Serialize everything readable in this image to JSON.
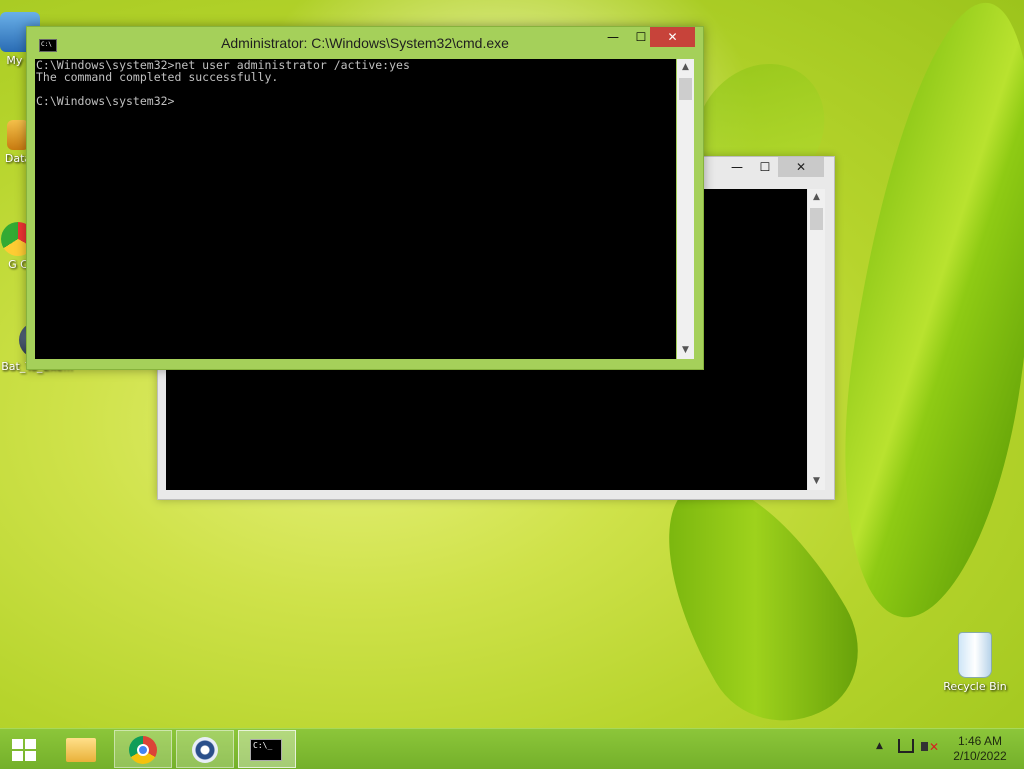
{
  "desktop": {
    "icons": [
      {
        "label": "My C",
        "icon": "computer-icon"
      },
      {
        "label": "Data",
        "icon": "data-icon"
      },
      {
        "label": "G C",
        "icon": "chrome-shortcut-icon"
      },
      {
        "label": "Bat_To_Exe...",
        "icon": "bat-to-exe-icon"
      },
      {
        "label": "Recycle Bin",
        "icon": "recycle-bin-icon"
      }
    ]
  },
  "front_window": {
    "title": "Administrator: C:\\Windows\\System32\\cmd.exe",
    "icon_text": "C:\\",
    "controls": {
      "minimize": "—",
      "maximize": "☐",
      "close": "✕"
    },
    "lines": [
      "C:\\Windows\\system32>net user administrator /active:yes",
      "The command completed successfully.",
      "",
      "C:\\Windows\\system32>"
    ]
  },
  "back_window": {
    "controls": {
      "minimize": "—",
      "maximize": "☐",
      "close": "✕"
    }
  },
  "scrollbar": {
    "up": "▲",
    "down": "▼"
  },
  "taskbar": {
    "items": [
      {
        "name": "start",
        "icon": "windows-logo-icon"
      },
      {
        "name": "file-explorer",
        "icon": "folder-icon"
      },
      {
        "name": "chrome",
        "icon": "chrome-icon"
      },
      {
        "name": "settings",
        "icon": "gear-icon"
      },
      {
        "name": "command-prompt",
        "icon": "cmd-icon"
      }
    ],
    "cmd_icon_text": "C:\\_",
    "tray_up": "▲",
    "volume_mark": "✕",
    "time": "1:46 AM",
    "date": "2/10/2022"
  },
  "colors": {
    "window_frame_active": "#a5d05a",
    "close_button": "#c7433a",
    "console_bg": "#000000",
    "console_text": "#c0c0c0",
    "taskbar": "#7fba30"
  }
}
